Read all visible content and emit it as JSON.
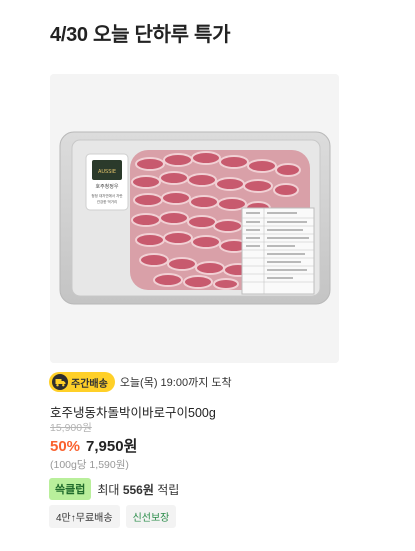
{
  "section": {
    "title": "4/30 오늘 단하루 특가"
  },
  "product": {
    "image_alt": "호주냉동차돌박이바로구이500g",
    "package_label_lines": [
      "AUSSIE",
      "BEEF",
      "호주청정우"
    ],
    "package_caption": [
      "청정 대자연에서 자란",
      "건강한 먹거리"
    ],
    "delivery_badge": "주간배송",
    "delivery_text": "오늘(목) 19:00까지 도착",
    "name": "호주냉동차돌박이바로구이500g",
    "original_price": "15,900원",
    "discount_rate": "50%",
    "sale_price": "7,950원",
    "unit_price": "(100g당 1,590원)",
    "point_badge": "쓱클럽",
    "point_prefix": "최대",
    "point_amount": "556원",
    "point_suffix": "적립",
    "tags": [
      "4만↑무료배송",
      "신선보장"
    ]
  },
  "colors": {
    "discount": "#fa622f",
    "delivery_badge_bg": "#ffd028",
    "point_badge_bg": "#b9ef9b",
    "fresh_tag_text": "#2a8c49"
  },
  "icons": {
    "cart": "cart-icon",
    "truck": "truck-icon"
  }
}
